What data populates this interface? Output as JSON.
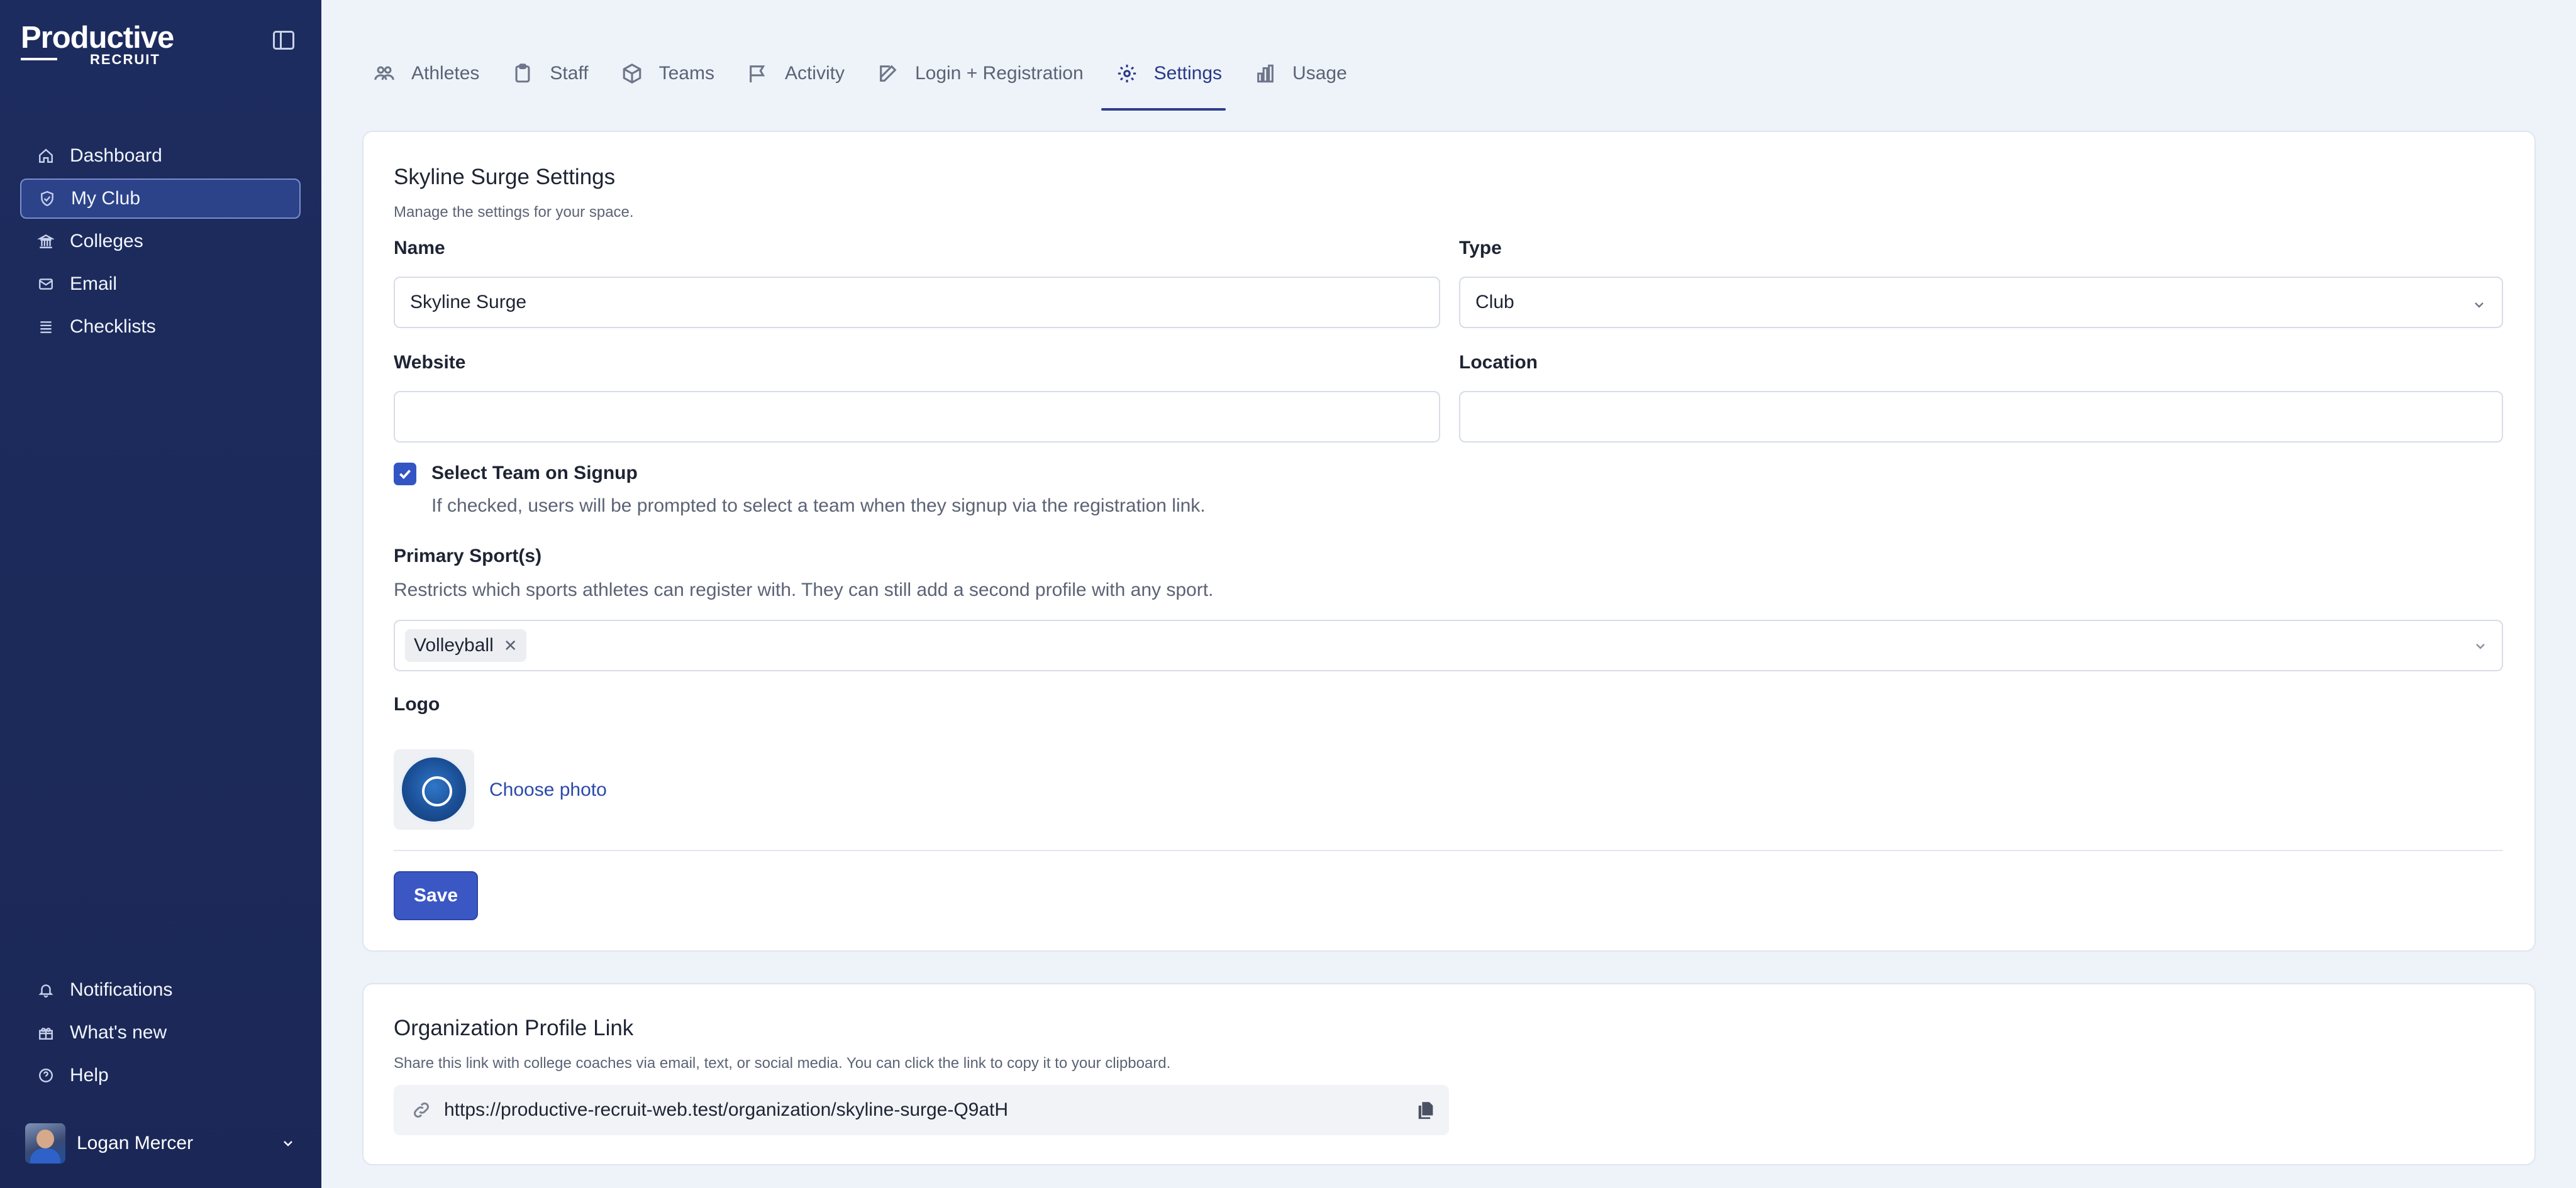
{
  "app": {
    "logo_word": "Productive",
    "logo_sub": "RECRUIT"
  },
  "sidebar": {
    "items": [
      {
        "label": "Dashboard",
        "icon": "home-icon"
      },
      {
        "label": "My Club",
        "icon": "shield-icon",
        "active": true
      },
      {
        "label": "Colleges",
        "icon": "building-icon"
      },
      {
        "label": "Email",
        "icon": "mail-icon"
      },
      {
        "label": "Checklists",
        "icon": "list-icon"
      }
    ],
    "bottom_items": [
      {
        "label": "Notifications",
        "icon": "bell-icon"
      },
      {
        "label": "What's new",
        "icon": "gift-icon"
      },
      {
        "label": "Help",
        "icon": "help-circle-icon"
      }
    ],
    "user_name": "Logan Mercer"
  },
  "tabs": [
    {
      "label": "Athletes",
      "icon": "users-icon"
    },
    {
      "label": "Staff",
      "icon": "clipboard-icon"
    },
    {
      "label": "Teams",
      "icon": "cube-icon"
    },
    {
      "label": "Activity",
      "icon": "flag-icon"
    },
    {
      "label": "Login + Registration",
      "icon": "pencil-icon"
    },
    {
      "label": "Settings",
      "icon": "gear-icon",
      "active": true
    },
    {
      "label": "Usage",
      "icon": "bar-chart-icon"
    }
  ],
  "settings": {
    "title": "Skyline Surge Settings",
    "subtitle": "Manage the settings for your space.",
    "name_label": "Name",
    "name_value": "Skyline Surge",
    "type_label": "Type",
    "type_value": "Club",
    "website_label": "Website",
    "website_value": "",
    "location_label": "Location",
    "location_value": "",
    "select_team_label": "Select Team on Signup",
    "select_team_checked": true,
    "select_team_desc": "If checked, users will be prompted to select a team when they signup via the registration link.",
    "sports_label": "Primary Sport(s)",
    "sports_desc": "Restricts which sports athletes can register with. They can still add a second profile with any sport.",
    "sports_selected": [
      "Volleyball"
    ],
    "logo_label": "Logo",
    "choose_photo": "Choose photo",
    "save_label": "Save"
  },
  "profile_link": {
    "title": "Organization Profile Link",
    "subtitle": "Share this link with college coaches via email, text, or social media. You can click the link to copy it to your clipboard.",
    "url": "https://productive-recruit-web.test/organization/skyline-surge-Q9atH"
  },
  "colors": {
    "sidebar_bg": "#1d2c5e",
    "accent": "#3a57c4",
    "active_tab": "#2a3a86"
  }
}
